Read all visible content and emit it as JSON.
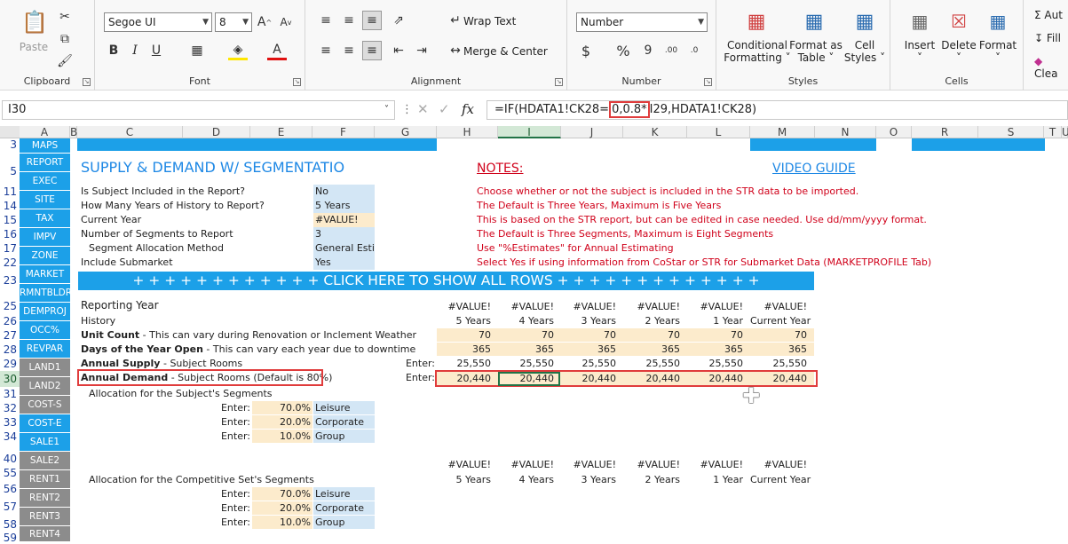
{
  "ribbon": {
    "clipboard": {
      "label": "Clipboard",
      "paste": "Paste"
    },
    "font": {
      "label": "Font",
      "family": "Segoe UI",
      "size": "8"
    },
    "alignment": {
      "label": "Alignment",
      "wrap": "Wrap Text",
      "merge": "Merge & Center"
    },
    "number": {
      "label": "Number",
      "format": "Number"
    },
    "styles": {
      "label": "Styles",
      "cond1": "Conditional",
      "cond2": "Formatting",
      "fmt1": "Format as",
      "fmt2": "Table",
      "cell1": "Cell",
      "cell2": "Styles"
    },
    "cells": {
      "label": "Cells",
      "insert": "Insert",
      "delete": "Delete",
      "format": "Format"
    },
    "editing": {
      "autosum": "Aut",
      "fill": "Fill",
      "clear": "Clea"
    }
  },
  "formula_bar": {
    "namebox": "I30",
    "formula_pre": "=IF(HDATA1!CK28=",
    "formula_hl": "0,0.8*",
    "formula_post": "I29,HDATA1!CK28)"
  },
  "columns": [
    {
      "l": "A"
    },
    {
      "l": "B"
    },
    {
      "l": "C"
    },
    {
      "l": "D"
    },
    {
      "l": "E"
    },
    {
      "l": "F"
    },
    {
      "l": "G"
    },
    {
      "l": "H"
    },
    {
      "l": "I"
    },
    {
      "l": "J"
    },
    {
      "l": "K"
    },
    {
      "l": "L"
    },
    {
      "l": "M"
    },
    {
      "l": "N"
    },
    {
      "l": "O"
    },
    {
      "l": "R"
    },
    {
      "l": "S"
    },
    {
      "l": "T"
    },
    {
      "l": "U"
    }
  ],
  "rows": [
    "3",
    "5",
    "11",
    "14",
    "15",
    "16",
    "17",
    "22",
    "23",
    "25",
    "26",
    "27",
    "28",
    "29",
    "30",
    "31",
    "32",
    "33",
    "34",
    "40",
    "55",
    "56",
    "57",
    "58",
    "59"
  ],
  "nav": [
    "MAPS",
    "REPORT",
    "EXEC",
    "SITE",
    "TAX",
    "IMPV",
    "ZONE",
    "MARKET",
    "RMNTBLDR",
    "DEMPROJ",
    "OCC%",
    "REVPAR",
    "LAND1",
    "LAND2",
    "COST-S",
    "COST-E",
    "SALE1",
    "SALE2",
    "RENT1",
    "RENT2",
    "RENT3",
    "RENT4"
  ],
  "sheet": {
    "title": "SUPPLY & DEMAND W/ SEGMENTATIO",
    "notes_title": "NOTES:",
    "video": "VIDEO GUIDE",
    "settings": [
      {
        "label": "Is Subject Included in the Report?",
        "value": "No",
        "note": "Choose whether or not the subject is included in the STR data to be imported."
      },
      {
        "label": "How Many Years of History to Report?",
        "value": "5 Years",
        "note": "The Default is Three Years, Maximum is Five Years"
      },
      {
        "label": "Current Year",
        "value": "#VALUE!",
        "note": "This is based on the STR report, but can be edited in case needed. Use dd/mm/yyyy format."
      },
      {
        "label": "Number of Segments to Report",
        "value": "3",
        "note": "The Default is Three Segments, Maximum is Eight Segments"
      },
      {
        "label": "Segment Allocation Method",
        "value": "General Estima",
        "note": "Use \"%Estimates\" for Annual Estimating"
      },
      {
        "label": "Include Submarket",
        "value": "Yes",
        "note": "Select Yes if using information from CoStar or STR for Submarket Data (MARKETPROFILE Tab)"
      }
    ],
    "banner": "+ + + + + + + + + + + + CLICK HERE TO SHOW ALL ROWS + + + + + + + + + + + + +",
    "reporting_year": "Reporting Year",
    "history": "History",
    "value_err": "#VALUE!",
    "years": [
      "5 Years",
      "4 Years",
      "3 Years",
      "2 Years",
      "1 Year",
      "Current Year"
    ],
    "unit_count_b": "Unit Count",
    "unit_count_r": " - This can vary during Renovation or Inclement Weather",
    "days_b": "Days of the Year Open",
    "days_r": " - This can vary each year due to downtime",
    "supply_b": "Annual Supply",
    "supply_r": "  - Subject Rooms",
    "demand_b": "Annual Demand",
    "demand_r": " - Subject Rooms (Default is 80%)",
    "enter": "Enter:",
    "unit_vals": [
      "70",
      "70",
      "70",
      "70",
      "70",
      "70"
    ],
    "days_vals": [
      "365",
      "365",
      "365",
      "365",
      "365",
      "365"
    ],
    "supply_vals": [
      "25,550",
      "25,550",
      "25,550",
      "25,550",
      "25,550",
      "25,550"
    ],
    "demand_vals": [
      "20,440",
      "20,440",
      "20,440",
      "20,440",
      "20,440",
      "20,440"
    ],
    "alloc_subject": "Allocation for the Subject's Segments",
    "alloc_comp": "Allocation for the Competitive Set's Segments",
    "segments": [
      {
        "pct": "70.0%",
        "name": "Leisure"
      },
      {
        "pct": "20.0%",
        "name": "Corporate"
      },
      {
        "pct": "10.0%",
        "name": "Group"
      }
    ],
    "comp_years": [
      "5 Years",
      "4 Years",
      "3 Years",
      "2 Years",
      "1 Year",
      "Current Year"
    ]
  }
}
